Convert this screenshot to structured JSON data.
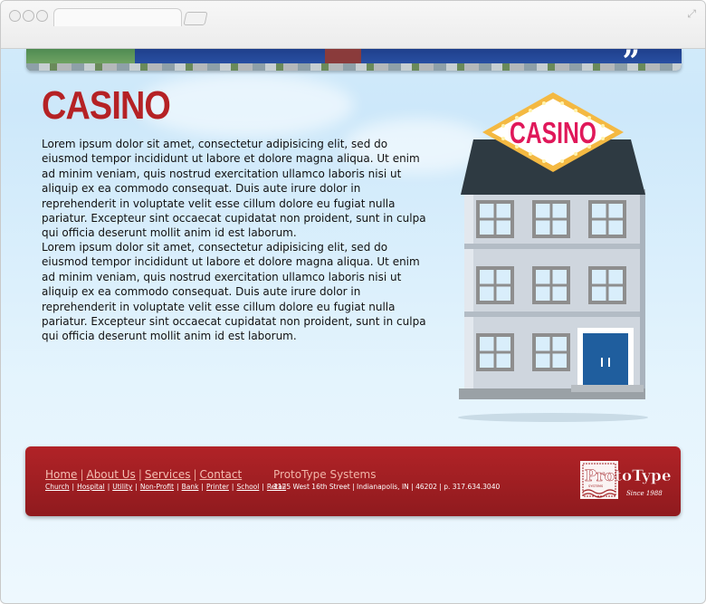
{
  "page": {
    "heading": "CASINO",
    "paragraphs": [
      "Lorem ipsum dolor sit amet, consectetur adipisicing elit, sed do eiusmod tempor incididunt ut labore et dolore magna aliqua. Ut enim ad minim veniam, quis nostrud exercitation ullamco laboris nisi ut aliquip ex ea commodo consequat. Duis aute irure dolor in reprehenderit in voluptate velit esse cillum dolore eu fugiat nulla pariatur. Excepteur sint occaecat cupidatat non proident, sunt in culpa qui officia deserunt mollit anim id est laborum.",
      "Lorem ipsum dolor sit amet, consectetur adipisicing elit, sed do eiusmod tempor incididunt ut labore et dolore magna aliqua. Ut enim ad minim veniam, quis nostrud exercitation ullamco laboris nisi ut aliquip ex ea commodo consequat. Duis aute irure dolor in reprehenderit in voluptate velit esse cillum dolore eu fugiat nulla pariatur. Excepteur sint occaecat cupidatat non proident, sunt in culpa qui officia deserunt mollit anim id est laborum."
    ],
    "sign_text": "CASINO"
  },
  "footer": {
    "main_links": [
      "Home",
      "About Us",
      "Services",
      "Contact"
    ],
    "sub_links": [
      "Church",
      "Hospital",
      "Utility",
      "Non-Profit",
      "Bank",
      "Printer",
      "School",
      "Retail"
    ],
    "company": "ProtoType Systems",
    "address": "1125 West 16th Street | Indianapolis, IN | 46202 | p. 317.634.3040",
    "logo_text": "ProtoType",
    "logo_small": "SYSTEMS",
    "logo_since": "Since 1988"
  },
  "colors": {
    "heading": "#b52225",
    "footer": "#a11f23",
    "sign": "#e0185a",
    "door": "#1f5e9e"
  }
}
